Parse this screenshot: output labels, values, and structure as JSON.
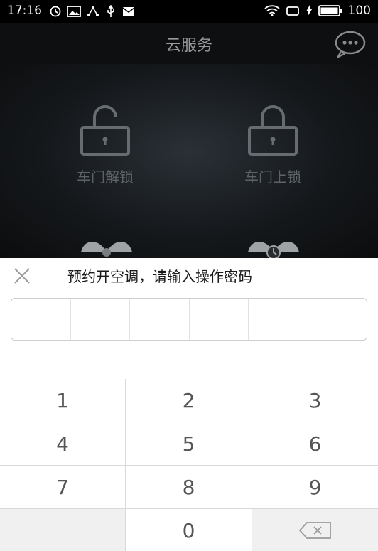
{
  "status_bar": {
    "time": "17:16",
    "battery": "100"
  },
  "header": {
    "title": "云服务"
  },
  "services": [
    {
      "label": "车门解锁"
    },
    {
      "label": "车门上锁"
    }
  ],
  "dialog": {
    "title": "预约开空调，请输入操作密码"
  },
  "keypad": {
    "keys": [
      "1",
      "2",
      "3",
      "4",
      "5",
      "6",
      "7",
      "8",
      "9",
      "",
      "0",
      ""
    ]
  },
  "colors": {
    "overlay_bg": "#000000",
    "dialog_bg": "#ffffff",
    "key_text": "#555555",
    "label_gray": "#5e6367"
  }
}
